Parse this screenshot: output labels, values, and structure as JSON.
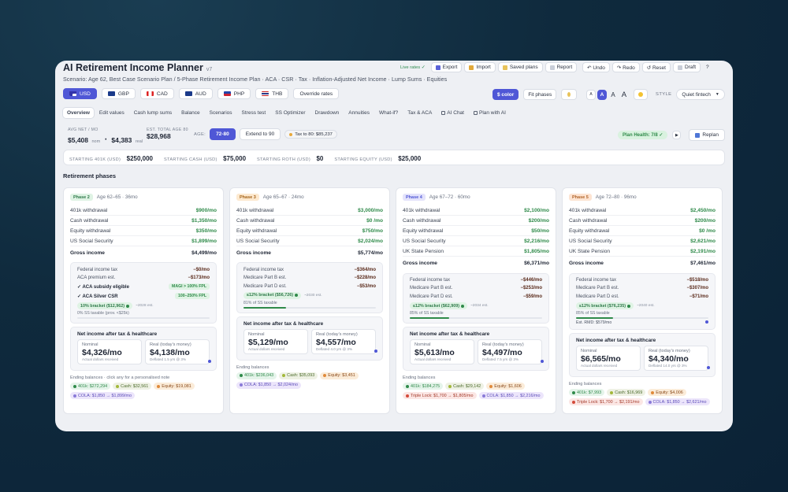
{
  "app": {
    "title": "AI Retirement Income Planner",
    "version": "v7",
    "subtitle": "Scenario: Age 62, Best Case Scenario Plan / 5-Phase Retirement Income Plan · ACA · CSR · Tax · Inflation-Adjusted Net Income · Lump Sums · Equities"
  },
  "toolbar": {
    "live": "Live rates ✓",
    "export": "Export",
    "import": "Import",
    "saved": "Saved plans",
    "report": "Report",
    "undo": "↶ Undo",
    "redo": "↷ Redo",
    "reset": "↺ Reset",
    "draft": "Draft",
    "help": "?"
  },
  "currencies": [
    {
      "code": "USD",
      "active": true
    },
    {
      "code": "GBP"
    },
    {
      "code": "CAD"
    },
    {
      "code": "AUD"
    },
    {
      "code": "PHP"
    },
    {
      "code": "THB"
    }
  ],
  "override": "Override rates",
  "controls": {
    "color": "$ color",
    "fit": "Fit phases",
    "font_sizes": [
      "A",
      "A",
      "A",
      "A"
    ],
    "style_label": "STYLE",
    "style_value": "Quiet fintech"
  },
  "colors": {
    "accent": "#4f57d6",
    "green": "#2f8a4a",
    "brown": "#7a4a2a"
  },
  "tabs": [
    "Overview",
    "Edit values",
    "Cash lump sums",
    "Balance",
    "Scenarios",
    "Stress test",
    "SS Optimizer",
    "Drawdown",
    "Annuities",
    "What-if?",
    "Tax & ACA",
    "AI Chat",
    "Plan with AI"
  ],
  "summary": {
    "avg_label": "AVG NET / MO",
    "avg_nom": "$5,408",
    "nom": "nom",
    "avg_real": "$4,383",
    "real": "real",
    "est_label": "EST. TOTAL AGE 80",
    "est_value": "$28,968",
    "age_label": "AGE:",
    "age_range": "72-80",
    "extend": "Extend to 90",
    "tax_to_80": "Tax to 80: $85,237",
    "health": "Plan Health: 7/8 ✓",
    "replan": "Replan"
  },
  "starting": [
    {
      "k": "STARTING 401K (USD)",
      "v": "$250,000"
    },
    {
      "k": "STARTING CASH (USD)",
      "v": "$75,000"
    },
    {
      "k": "STARTING ROTH (USD)",
      "v": "$0"
    },
    {
      "k": "STARTING EQUITY (USD)",
      "v": "$25,000"
    }
  ],
  "section": "Retirement phases",
  "phases": [
    {
      "pill": "Phase 2",
      "age": "Age 62–65 · 36mo",
      "rows": [
        {
          "k": "401k withdrawal",
          "v": "$900/mo"
        },
        {
          "k": "Cash withdrawal",
          "v": "$1,350/mo"
        },
        {
          "k": "Equity withdrawal",
          "v": "$350/mo"
        },
        {
          "k": "US Social Security",
          "v": "$1,899/mo"
        }
      ],
      "gross_label": "Gross income",
      "gross": "$4,499/mo",
      "tax": [
        {
          "k": "Federal income tax",
          "v": "−$0/mo"
        },
        {
          "k": "ACA premium est.",
          "v": "−$173/mo"
        }
      ],
      "aca1": "✓ ACA subsidy eligible",
      "aca1b": "MAGI > 100% FPL",
      "aca2": "✓ ACA Silver CSR",
      "aca2b": "100–250% FPL",
      "bracket": "10% bracket ($12,962)",
      "bracket_est": "~2028 est.",
      "ss_tax": "0% SS taxable (prov. <$25k)",
      "progress": 0,
      "net_title": "Net income after tax & healthcare",
      "nominal_label": "Nominal",
      "nominal": "$4,326/mo",
      "nominal_sub": "Actual dollars received",
      "real_label": "Real (today's money)",
      "real": "$4,138/mo",
      "real_sub": "Deflated 1.5 yrs @ 3%",
      "end_label": "Ending balances · click any for a personalised note",
      "chips": [
        {
          "t": "401k: $272,294"
        },
        {
          "t": "Cash: $32,561"
        },
        {
          "t": "Equity: $19,081"
        },
        {
          "t": "COLA: $1,850 → $1,899/mo"
        }
      ]
    },
    {
      "pill": "Phase 3",
      "age": "Age 65–67 · 24mo",
      "rows": [
        {
          "k": "401k withdrawal",
          "v": "$3,000/mo"
        },
        {
          "k": "Cash withdrawal",
          "v": "$0  /mo"
        },
        {
          "k": "Equity withdrawal",
          "v": "$750/mo"
        },
        {
          "k": "US Social Security",
          "v": "$2,024/mo"
        }
      ],
      "gross_label": "Gross income",
      "gross": "$5,774/mo",
      "tax": [
        {
          "k": "Federal income tax",
          "v": "−$364/mo"
        },
        {
          "k": "Medicare Part B est.",
          "v": "−$228/mo"
        },
        {
          "k": "Medicare Part D est.",
          "v": "−$53/mo"
        }
      ],
      "bracket": "≤12% bracket ($56,726)",
      "bracket_est": "~2030 est.",
      "ss_tax": "81% of SS taxable",
      "progress": 0.32,
      "net_title": "Net income after tax & healthcare",
      "nominal_label": "Nominal",
      "nominal": "$5,129/mo",
      "nominal_sub": "Actual dollars received",
      "real_label": "Real (today's money)",
      "real": "$4,557/mo",
      "real_sub": "Deflated 4.0 yrs @ 3%",
      "end_label": "Ending balances",
      "chips": [
        {
          "t": "401k: $236,043"
        },
        {
          "t": "Cash: $35,093"
        },
        {
          "t": "Equity: $3,451"
        },
        {
          "t": "COLA: $1,850 → $2,024/mo"
        }
      ]
    },
    {
      "pill": "Phase 4",
      "age": "Age 67–72 · 60mo",
      "rows": [
        {
          "k": "401k withdrawal",
          "v": "$2,100/mo"
        },
        {
          "k": "Cash withdrawal",
          "v": "$200/mo"
        },
        {
          "k": "Equity withdrawal",
          "v": "$50/mo"
        },
        {
          "k": "US Social Security",
          "v": "$2,216/mo"
        },
        {
          "k": "UK State Pension",
          "v": "$1,805/mo"
        }
      ],
      "gross_label": "Gross income",
      "gross": "$6,371/mo",
      "tax": [
        {
          "k": "Federal income tax",
          "v": "−$446/mo"
        },
        {
          "k": "Medicare Part B est.",
          "v": "−$253/mo"
        },
        {
          "k": "Medicare Part D est.",
          "v": "−$59/mo"
        }
      ],
      "bracket": "≤12% bracket ($62,909)",
      "bracket_est": "~2034 est.",
      "ss_tax": "85% of SS taxable",
      "progress": 0.3,
      "net_title": "Net income after tax & healthcare",
      "nominal_label": "Nominal",
      "nominal": "$5,613/mo",
      "nominal_sub": "Actual dollars received",
      "real_label": "Real (today's money)",
      "real": "$4,497/mo",
      "real_sub": "Deflated 7.5 yrs @ 3%",
      "end_label": "Ending balances",
      "chips": [
        {
          "t": "401k: $184,275"
        },
        {
          "t": "Cash: $29,142"
        },
        {
          "t": "Equity: $1,606"
        },
        {
          "t": "Triple Lock: $1,700 → $1,805/mo"
        },
        {
          "t": "COLA: $1,850 → $2,216/mo"
        }
      ]
    },
    {
      "pill": "Phase 5",
      "age": "Age 72–80 · 96mo",
      "rows": [
        {
          "k": "401k withdrawal",
          "v": "$2,450/mo"
        },
        {
          "k": "Cash withdrawal",
          "v": "$200/mo"
        },
        {
          "k": "Equity withdrawal",
          "v": "$0  /mo"
        },
        {
          "k": "US Social Security",
          "v": "$2,621/mo"
        },
        {
          "k": "UK State Pension",
          "v": "$2,191/mo"
        }
      ],
      "gross_label": "Gross income",
      "gross": "$7,461/mo",
      "tax": [
        {
          "k": "Federal income tax",
          "v": "−$518/mo"
        },
        {
          "k": "Medicare Part B est.",
          "v": "−$307/mo"
        },
        {
          "k": "Medicare Part D est.",
          "v": "−$71/mo"
        }
      ],
      "bracket": "≤12% bracket ($76,235)",
      "bracket_est": "~2040 est.",
      "ss_tax": "85% of SS taxable",
      "rmd": "Est. RMD: $579/mo",
      "progress": 0.28,
      "net_title": "Net income after tax & healthcare",
      "nominal_label": "Nominal",
      "nominal": "$6,565/mo",
      "nominal_sub": "Actual dollars received",
      "real_label": "Real (today's money)",
      "real": "$4,340/mo",
      "real_sub": "Deflated 14.0 yrs @ 3%",
      "end_label": "Ending balances",
      "chips": [
        {
          "t": "401k: $7,993"
        },
        {
          "t": "Cash: $16,969"
        },
        {
          "t": "Equity: $4,006"
        },
        {
          "t": "Triple Lock: $1,700 → $2,191/mo"
        },
        {
          "t": "COLA: $1,850 → $2,621/mo"
        }
      ]
    }
  ]
}
